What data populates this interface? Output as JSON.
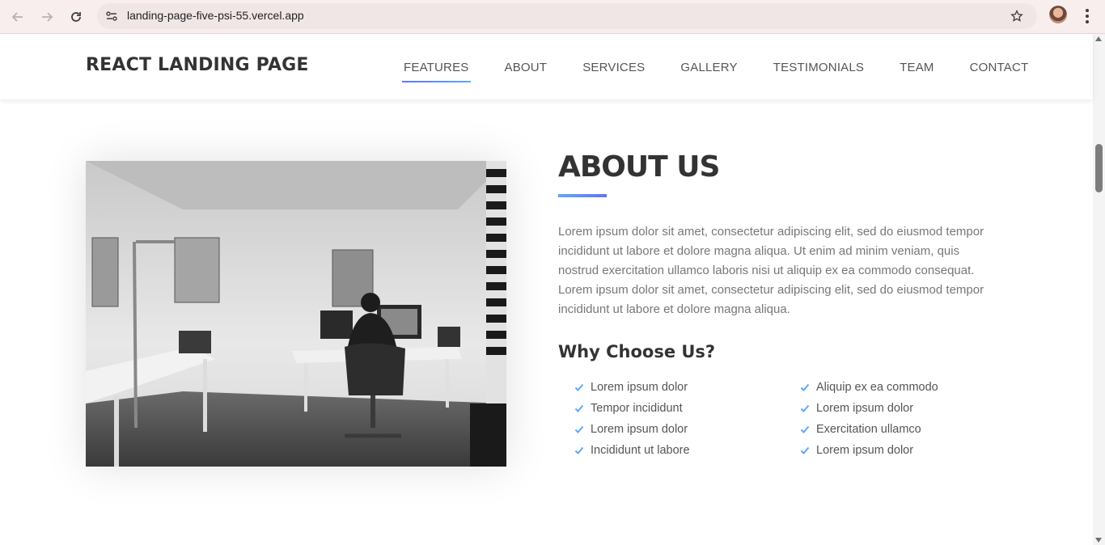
{
  "browser": {
    "url": "landing-page-five-psi-55.vercel.app",
    "icons": [
      "back-icon",
      "forward-icon",
      "reload-icon",
      "site-info-icon",
      "star-icon",
      "profile-avatar",
      "menu-kebab-icon"
    ]
  },
  "header": {
    "brand": "REACT LANDING PAGE",
    "nav": [
      {
        "label": "FEATURES",
        "active": true
      },
      {
        "label": "ABOUT",
        "active": false
      },
      {
        "label": "SERVICES",
        "active": false
      },
      {
        "label": "GALLERY",
        "active": false
      },
      {
        "label": "TESTIMONIALS",
        "active": false
      },
      {
        "label": "TEAM",
        "active": false
      },
      {
        "label": "CONTACT",
        "active": false
      }
    ]
  },
  "about": {
    "title": "ABOUT US",
    "paragraph": "Lorem ipsum dolor sit amet, consectetur adipiscing elit, sed do eiusmod tempor incididunt ut labore et dolore magna aliqua. Ut enim ad minim veniam, quis nostrud exercitation ullamco laboris nisi ut aliquip ex ea commodo consequat. Lorem ipsum dolor sit amet, consectetur adipiscing elit, sed do eiusmod tempor incididunt ut labore et dolore magna aliqua.",
    "why_title": "Why Choose Us?",
    "why_col1": [
      "Lorem ipsum dolor",
      "Tempor incididunt",
      "Lorem ipsum dolor",
      "Incididunt ut labore"
    ],
    "why_col2": [
      "Aliquip ex ea commodo",
      "Lorem ipsum dolor",
      "Exercitation ullamco",
      "Lorem ipsum dolor"
    ]
  },
  "colors": {
    "accent_start": "#5ca9fb",
    "accent_end": "#6372ff",
    "heading": "#333333",
    "body_text": "#777777"
  }
}
